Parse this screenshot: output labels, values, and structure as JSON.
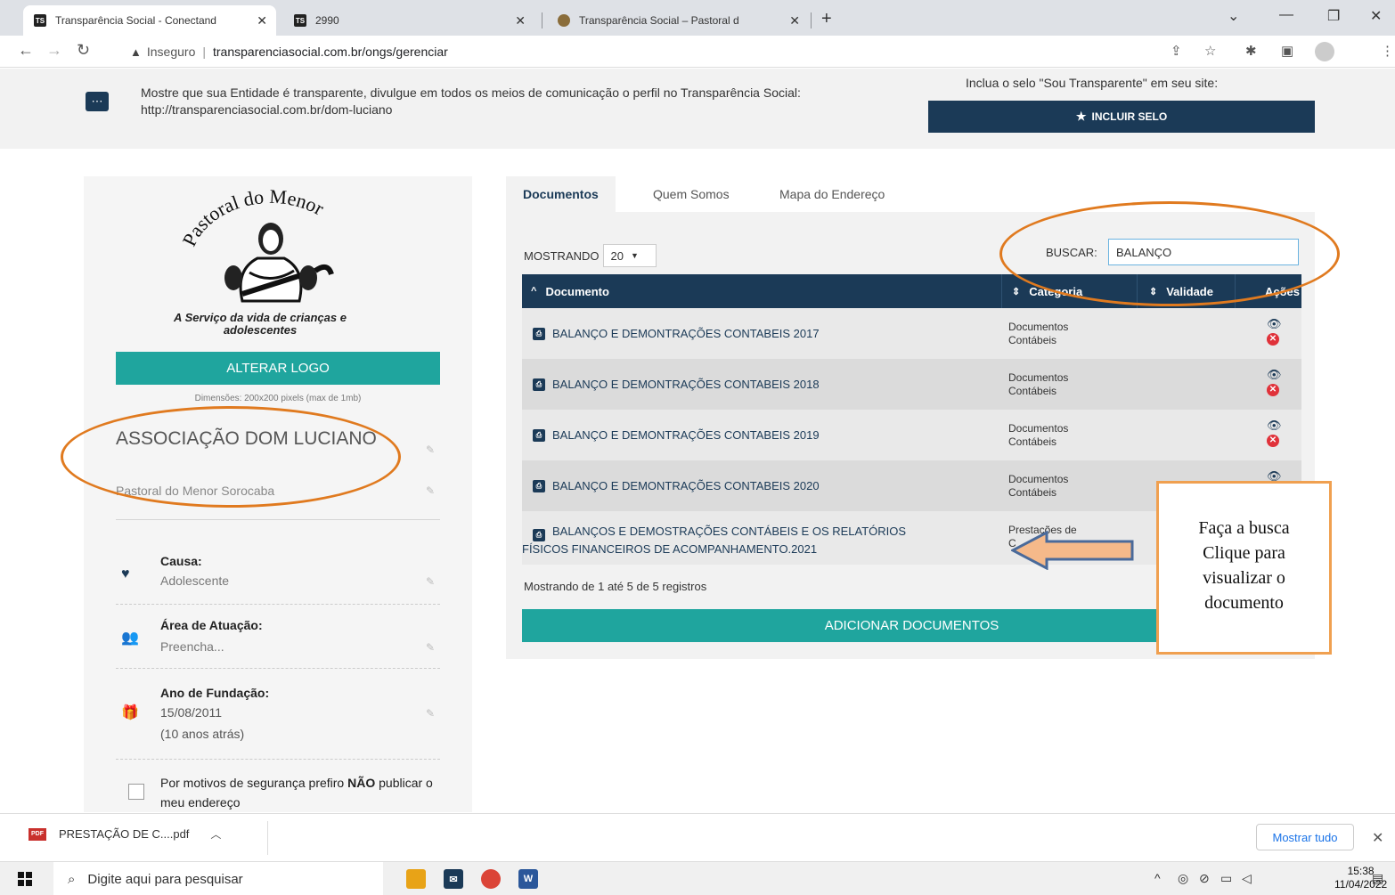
{
  "browser": {
    "tabs": [
      {
        "title": "Transparência Social - Conectand",
        "favicon": "TS",
        "active": true
      },
      {
        "title": "2990",
        "favicon": "TS",
        "active": false
      },
      {
        "title": "Transparência Social – Pastoral d",
        "favicon": "pastoral",
        "active": false
      }
    ],
    "address": {
      "security": "Inseguro",
      "url": "transparenciasocial.com.br/ongs/gerenciar"
    }
  },
  "banner": {
    "message": "Mostre que sua Entidade é transparente, divulgue em todos os meios de comunicação o perfil no Transparência Social: http://transparenciasocial.com.br/dom-luciano",
    "selo_text": "Inclua o selo \"Sou Transparente\" em seu site:",
    "selo_button": "INCLUIR SELO"
  },
  "sidebar": {
    "logo_tagline": "A Serviço da vida de crianças e adolescentes",
    "change_logo": "ALTERAR LOGO",
    "dimensions_note": "Dimensões: 200x200 pixels (max de 1mb)",
    "org_name": "ASSOCIAÇÃO DOM LUCIANO",
    "org_subtitle": "Pastoral do Menor Sorocaba",
    "cause_title": "Causa:",
    "cause_value": "Adolescente",
    "area_title": "Área de Atuação:",
    "area_value": "Preencha...",
    "founded_title": "Ano de Fundação:",
    "founded_date": "15/08/2011",
    "founded_ago": "(10 anos atrás)",
    "privacy_pre": "Por motivos de segurança prefiro ",
    "privacy_bold": "NÃO",
    "privacy_post": " publicar o meu endereço"
  },
  "main": {
    "tabs": [
      "Documentos",
      "Quem Somos",
      "Mapa do Endereço"
    ],
    "showing_label": "MOSTRANDO",
    "page_size": "20",
    "search_label": "BUSCAR:",
    "search_value": "BALANÇO",
    "columns": [
      "Documento",
      "Categoria",
      "Validade",
      "Ações"
    ],
    "rows": [
      {
        "document": "BALANÇO E DEMONTRAÇÕES CONTABEIS 2017",
        "cat1": "Documentos",
        "cat2": "Contábeis"
      },
      {
        "document": "BALANÇO E DEMONTRAÇÕES CONTABEIS 2018",
        "cat1": "Documentos",
        "cat2": "Contábeis"
      },
      {
        "document": "BALANÇO E DEMONTRAÇÕES CONTABEIS 2019",
        "cat1": "Documentos",
        "cat2": "Contábeis"
      },
      {
        "document": "BALANÇO E DEMONTRAÇÕES CONTABEIS 2020",
        "cat1": "Documentos",
        "cat2": "Contábeis"
      },
      {
        "document_line1": "BALANÇOS E DEMOSTRAÇÕES CONTÁBEIS E OS RELATÓRIOS",
        "document_line2": "FÍSICOS FINANCEIROS DE ACOMPANHAMENTO.2021",
        "cat1": "Prestações de",
        "cat2": "C"
      }
    ],
    "records_info": "Mostrando de 1 até 5 de 5 registros",
    "add_button": "ADICIONAR DOCUMENTOS"
  },
  "annotation": {
    "line1": "Faça a busca",
    "line2": "Clique para",
    "line3": "visualizar o",
    "line4": "documento"
  },
  "downloads": {
    "file": "PRESTAÇÃO DE C....pdf",
    "show_all": "Mostrar tudo"
  },
  "taskbar": {
    "search_placeholder": "Digite aqui para pesquisar",
    "time": "15:38",
    "date": "11/04/2022"
  },
  "colors": {
    "navy": "#1b3a57",
    "teal": "#1fa59e",
    "annotation_orange": "#e07a1f",
    "delete_red": "#e0323a"
  }
}
